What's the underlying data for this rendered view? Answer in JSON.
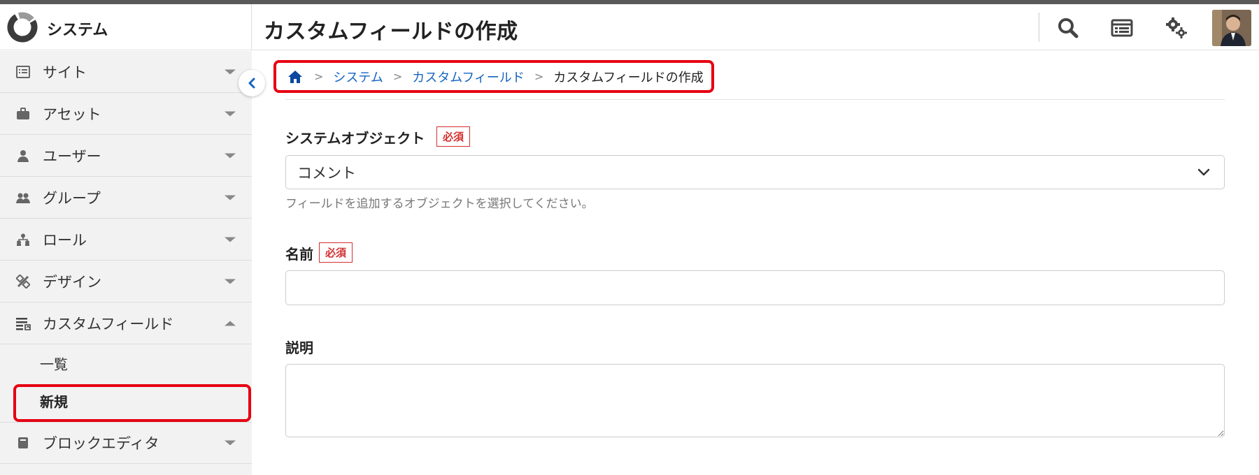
{
  "header": {
    "brand": "システム",
    "title": "カスタムフィールドの作成",
    "actions": [
      {
        "name": "search",
        "icon": "search-icon"
      },
      {
        "name": "dashboard",
        "icon": "browser-window-icon"
      },
      {
        "name": "settings",
        "icon": "gears-icon"
      }
    ],
    "avatar_icon": "user-avatar"
  },
  "sidebar": {
    "items": [
      {
        "label": "サイト",
        "icon": "list-window-icon"
      },
      {
        "label": "アセット",
        "icon": "briefcase-icon"
      },
      {
        "label": "ユーザー",
        "icon": "user-icon"
      },
      {
        "label": "グループ",
        "icon": "users-icon"
      },
      {
        "label": "ロール",
        "icon": "sitemap-icon"
      },
      {
        "label": "デザイン",
        "icon": "design-tools-icon"
      },
      {
        "label": "カスタムフィールド",
        "icon": "custom-field-icon",
        "expanded": true
      },
      {
        "label": "ブロックエディタ",
        "icon": "book-icon"
      }
    ],
    "sub_items": [
      {
        "label": "一覧",
        "active": false
      },
      {
        "label": "新規",
        "active": true
      }
    ]
  },
  "breadcrumb": {
    "items": [
      "システム",
      "カスタムフィールド"
    ],
    "current": "カスタムフィールドの作成"
  },
  "form": {
    "required_badge": "必須",
    "system_object": {
      "label": "システムオブジェクト",
      "value": "コメント",
      "help": "フィールドを追加するオブジェクトを選択してください。"
    },
    "name": {
      "label": "名前",
      "value": ""
    },
    "description": {
      "label": "説明",
      "value": ""
    }
  },
  "colors": {
    "link": "#1565c0",
    "required": "#d32f2f",
    "highlight": "#e60012",
    "sidebar_bg": "#f2f2f2"
  }
}
